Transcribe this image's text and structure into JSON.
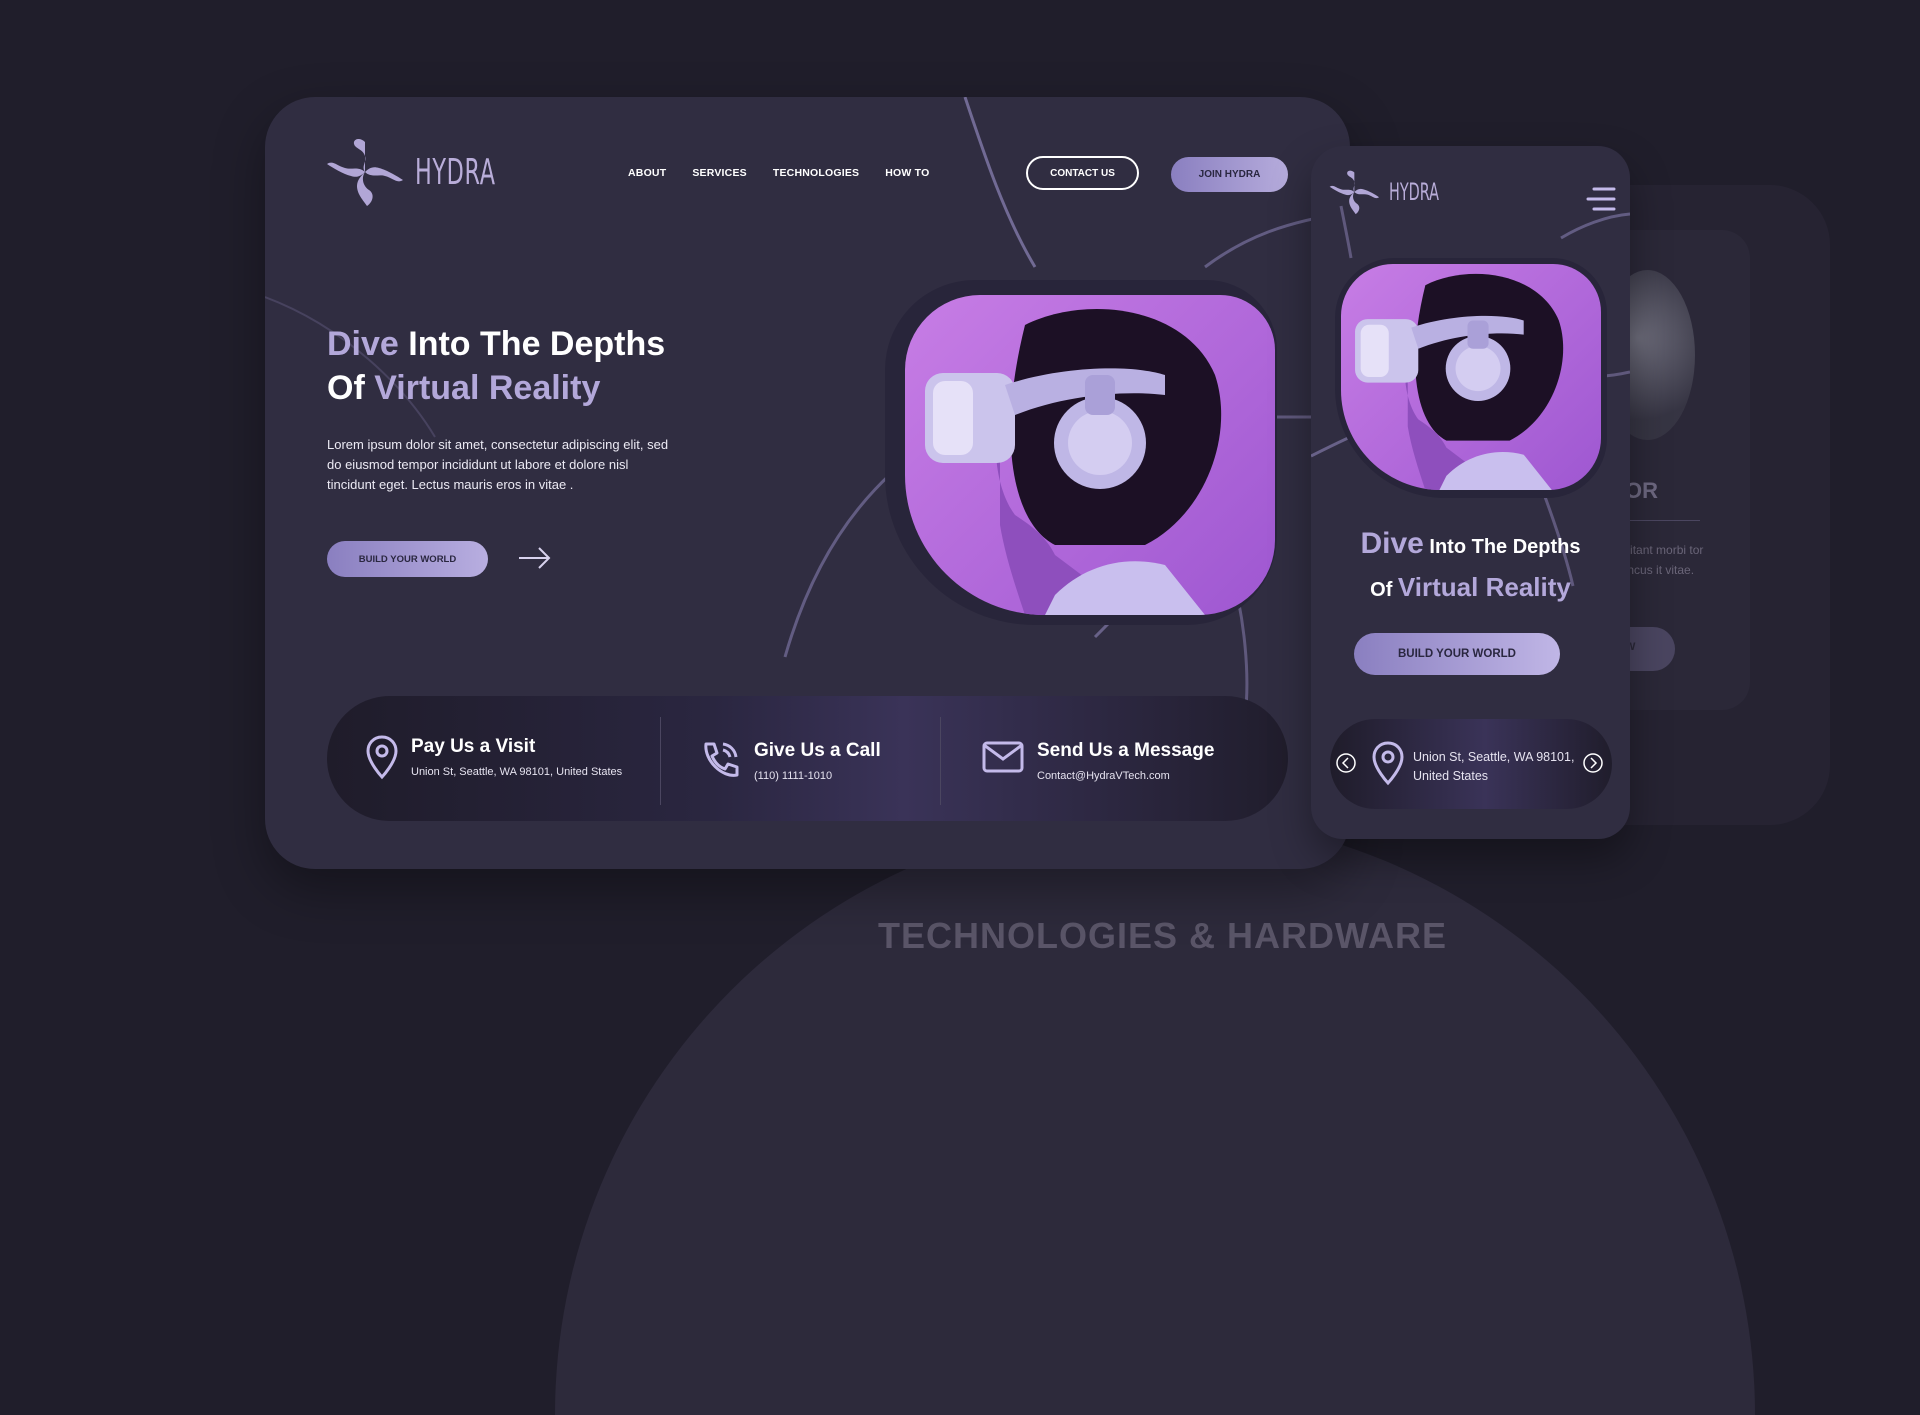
{
  "background": {
    "section_title": "TECHNOLOGIES & HARDWARE",
    "back_card": {
      "heading": "OR",
      "text": "habitant morbi tor rhoncus it vitae.",
      "button": "W"
    }
  },
  "desktop": {
    "brand": "HYDRA",
    "nav": [
      "ABOUT",
      "SERVICES",
      "TECHNOLOGIES",
      "HOW TO"
    ],
    "contact_label": "CONTACT US",
    "join_label": "JOIN HYDRA",
    "hero": {
      "title_hl1": "Dive",
      "title_part1": " Into The Depths",
      "title_part2": "Of ",
      "title_hl2": "Virtual Reality",
      "description": "Lorem ipsum dolor sit amet, consectetur adipiscing elit, sed do eiusmod tempor incididunt ut labore et dolore nisl tincidunt eget. Lectus mauris eros in vitae .",
      "cta_label": "BUILD YOUR WORLD"
    },
    "info": [
      {
        "icon": "map-pin-icon",
        "title": "Pay Us a Visit",
        "sub": "Union St, Seattle, WA 98101, United States"
      },
      {
        "icon": "phone-icon",
        "title": "Give Us a Call",
        "sub": "(110) 1111-1010"
      },
      {
        "icon": "mail-icon",
        "title": "Send Us a Message",
        "sub": "Contact@HydraVTech.com"
      }
    ]
  },
  "mobile": {
    "brand": "HYDRA",
    "title_hl1": "Dive",
    "title_part1": " Into The Depths",
    "title_part2": "Of ",
    "title_hl2": "Virtual Reality",
    "cta_label": "BUILD YOUR WORLD",
    "address": "Union St, Seattle, WA 98101, United States"
  },
  "colors": {
    "page_bg": "#201e2b",
    "card_bg": "#302d41",
    "accent": "#b3a8da",
    "photo_purple": "#b66ddd"
  }
}
